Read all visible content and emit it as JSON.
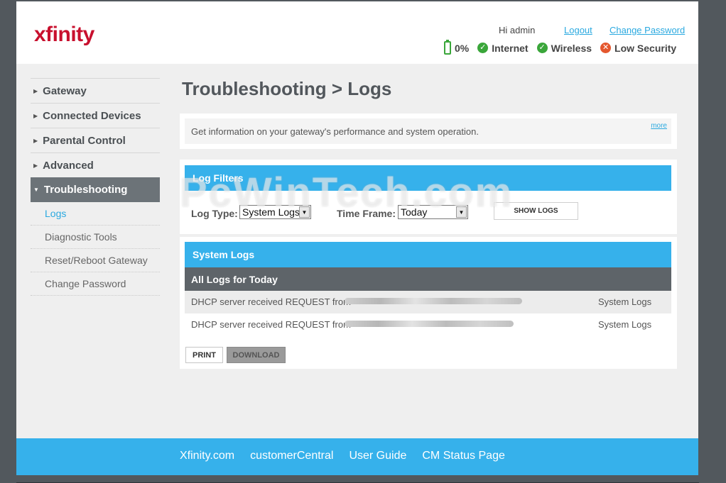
{
  "header": {
    "logo": "xfinity",
    "greeting": "Hi admin",
    "logout_label": "Logout",
    "change_password_label": "Change Password",
    "status": {
      "battery": "0%",
      "internet": "Internet",
      "wireless": "Wireless",
      "security": "Low Security"
    }
  },
  "sidebar": {
    "items": [
      {
        "label": "Gateway"
      },
      {
        "label": "Connected Devices"
      },
      {
        "label": "Parental Control"
      },
      {
        "label": "Advanced"
      },
      {
        "label": "Troubleshooting"
      }
    ],
    "subitems": [
      {
        "label": "Logs"
      },
      {
        "label": "Diagnostic Tools"
      },
      {
        "label": "Reset/Reboot Gateway"
      },
      {
        "label": "Change Password"
      }
    ]
  },
  "main": {
    "title": "Troubleshooting > Logs",
    "info_text": "Get information on your gateway's performance and system operation.",
    "more_label": "more",
    "filters": {
      "bar_title": "Log Filters",
      "log_type_label": "Log Type:",
      "log_type_value": "System Logs",
      "time_frame_label": "Time Frame:",
      "time_frame_value": "Today",
      "show_button": "SHOW LOGS"
    },
    "logs": {
      "bar_title": "System Logs",
      "sub_title": "All Logs for Today",
      "rows": [
        {
          "message": "DHCP server received REQUEST from",
          "type": "System Logs"
        },
        {
          "message": "DHCP server received REQUEST from",
          "type": "System Logs"
        }
      ],
      "print_label": "PRINT",
      "download_label": "DOWNLOAD"
    }
  },
  "watermark": "PcWinTech.com",
  "footer": {
    "links": [
      "Xfinity.com",
      "customerCentral",
      "User Guide",
      "CM Status Page"
    ]
  },
  "colors": {
    "accent": "#36b1eb",
    "brand": "#c8102e",
    "ok": "#3aa63a",
    "warning": "#e4572e",
    "nav_active": "#6c7378"
  }
}
